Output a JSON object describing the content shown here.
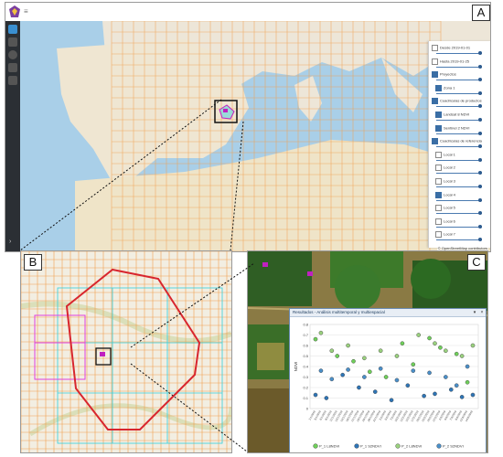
{
  "panels": {
    "a": "A",
    "b": "B",
    "c": "C"
  },
  "map_credits": "© OpenStreetMap contributors",
  "layers": [
    {
      "label": "Desde 2019-01-01",
      "checked": false
    },
    {
      "label": "Hasta 2019-01-25",
      "checked": false
    },
    {
      "label": "Proyectos",
      "checked": true
    },
    {
      "label": "Zona 1",
      "checked": true
    },
    {
      "label": "Cuadrículas de productos",
      "checked": true
    },
    {
      "label": "Landsat 8 NDVI",
      "checked": true
    },
    {
      "label": "Sentinel 2 NDVI",
      "checked": true
    },
    {
      "label": "Cuadrículas de referencia",
      "checked": true
    },
    {
      "label": "Local 1",
      "checked": false
    },
    {
      "label": "Local 2",
      "checked": false
    },
    {
      "label": "Local 3",
      "checked": false
    },
    {
      "label": "Local 4",
      "checked": true
    },
    {
      "label": "Local 5",
      "checked": false
    },
    {
      "label": "Local 6",
      "checked": false
    },
    {
      "label": "Local 7",
      "checked": false
    }
  ],
  "chart_window": {
    "title": "Resultados - Análisis multitemporal y multiespacial",
    "buttons": [
      "▾",
      "×"
    ]
  },
  "chart_data": {
    "type": "scatter",
    "ylabel": "NDVI",
    "ylim": [
      0,
      0.8
    ],
    "yticks": [
      "0",
      "0.1",
      "0.2",
      "0.3",
      "0.4",
      "0.5",
      "0.6",
      "0.7",
      "0.8"
    ],
    "categories": [
      "1/1/2019",
      "3/1/2019",
      "6/1/2019",
      "8/1/2019",
      "11/1/2019",
      "13/1/2019",
      "16/1/2019",
      "18/1/2019",
      "21/1/2019",
      "23/1/2019",
      "26/1/2019",
      "28/1/2019",
      "31/1/2019",
      "2/2/2019",
      "5/2/2019",
      "7/2/2019",
      "10/2/2019",
      "12/2/2019",
      "15/2/2019",
      "17/2/2019",
      "20/2/2019",
      "22/2/2019",
      "25/2/2019",
      "27/2/2019",
      "2/3/2019",
      "4/3/2019",
      "7/3/2019",
      "9/3/2019",
      "12/3/2019",
      "14/3/2019"
    ],
    "series": [
      {
        "name": "P_1 L8NDVI",
        "color": "#6fcf5a",
        "points": [
          [
            0,
            0.66
          ],
          [
            4,
            0.5
          ],
          [
            7,
            0.45
          ],
          [
            10,
            0.35
          ],
          [
            13,
            0.3
          ],
          [
            16,
            0.62
          ],
          [
            18,
            0.42
          ],
          [
            21,
            0.67
          ],
          [
            23,
            0.58
          ],
          [
            26,
            0.52
          ],
          [
            28,
            0.25
          ]
        ]
      },
      {
        "name": "P_1 S2NDVI",
        "color": "#2e75b6",
        "points": [
          [
            0,
            0.13
          ],
          [
            2,
            0.1
          ],
          [
            5,
            0.32
          ],
          [
            8,
            0.2
          ],
          [
            11,
            0.16
          ],
          [
            14,
            0.08
          ],
          [
            17,
            0.22
          ],
          [
            20,
            0.12
          ],
          [
            22,
            0.14
          ],
          [
            25,
            0.18
          ],
          [
            27,
            0.11
          ],
          [
            29,
            0.13
          ]
        ]
      },
      {
        "name": "P_2 L8NDVI",
        "color": "#9ad17e",
        "points": [
          [
            1,
            0.72
          ],
          [
            3,
            0.55
          ],
          [
            6,
            0.6
          ],
          [
            9,
            0.48
          ],
          [
            12,
            0.55
          ],
          [
            15,
            0.5
          ],
          [
            19,
            0.7
          ],
          [
            22,
            0.62
          ],
          [
            24,
            0.55
          ],
          [
            27,
            0.5
          ],
          [
            29,
            0.6
          ]
        ]
      },
      {
        "name": "P_2 S2NDVI",
        "color": "#4a8fc9",
        "points": [
          [
            1,
            0.36
          ],
          [
            3,
            0.28
          ],
          [
            6,
            0.37
          ],
          [
            9,
            0.3
          ],
          [
            12,
            0.38
          ],
          [
            15,
            0.27
          ],
          [
            18,
            0.36
          ],
          [
            21,
            0.34
          ],
          [
            24,
            0.3
          ],
          [
            26,
            0.22
          ],
          [
            28,
            0.4
          ]
        ]
      }
    ]
  }
}
